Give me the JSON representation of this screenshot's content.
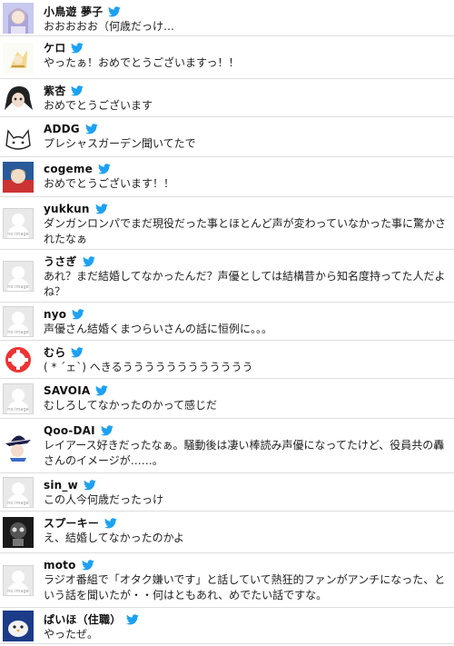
{
  "colors": {
    "bird": "#1da1f2",
    "divider": "#dedede",
    "placeholder_bg": "#e9e9e9"
  },
  "no_image_caption": "no image",
  "tweets": [
    {
      "name": "小鳥遊 夢子",
      "text": "おおおおお（何歳だっけ…",
      "avatar": "anime-girl-avatar",
      "h": 40
    },
    {
      "name": "ケロ",
      "text": "やったぁ！おめでとうございますっ！！",
      "avatar": "illustration-avatar",
      "h": 47
    },
    {
      "name": "紫杏",
      "text": "おめでとうございます",
      "avatar": "dark-hair-avatar",
      "h": 42
    },
    {
      "name": "ADDG",
      "text": "プレシャスガーデン聞いてたで",
      "avatar": "cat-sketch-avatar",
      "h": 44
    },
    {
      "name": "cogeme",
      "text": "おめでとうございます！！",
      "avatar": "anime-boy-avatar",
      "h": 44
    },
    {
      "name": "yukkun",
      "text": "ダンガンロンパでまだ現役だった事とほとんど声が変わっていなかった事に驚かされたなぁ",
      "avatar": "no-image-avatar",
      "h": 58
    },
    {
      "name": "うさぎ",
      "text": "あれ？まだ結婚してなかったんだ？声優としては結構昔から知名度持ってた人だよね？",
      "avatar": "no-image-avatar",
      "h": 58
    },
    {
      "name": "nyo",
      "text": "声優さん結婚くまつらいさんの話に恒例に。。。",
      "avatar": "no-image-avatar",
      "h": 42
    },
    {
      "name": "むら",
      "text": "( * ´ェ`) へきるうううううううううううう",
      "avatar": "lifebuoy-avatar",
      "h": 42
    },
    {
      "name": "SAVOIA",
      "text": "むしろしてなかったのかって感じだ",
      "avatar": "no-image-avatar",
      "h": 44
    },
    {
      "name": "Qoo-DAI",
      "text": "レイアース好きだったなぁ。騒動後は凄い棒読み声優になってたけど、役員共の轟さんのイメージが……。",
      "avatar": "hat-character-avatar",
      "h": 60
    },
    {
      "name": "sin_w",
      "text": "この人今何歳だったっけ",
      "avatar": "no-image-avatar",
      "h": 42
    },
    {
      "name": "スプーキー",
      "text": "え、結婚してなかったのかよ",
      "avatar": "robot-avatar",
      "h": 46
    },
    {
      "name": "moto",
      "text": "ラジオ番組で「オタク嫌いです」と話していて熱狂的ファンがアンチになった、という話を聞いたが・・何はともあれ、めでたい話ですな。",
      "avatar": "no-image-avatar",
      "h": 60
    },
    {
      "name": "ぱいほ（住職）",
      "text": "やったぜ。",
      "avatar": "penguin-avatar",
      "h": 40
    }
  ]
}
